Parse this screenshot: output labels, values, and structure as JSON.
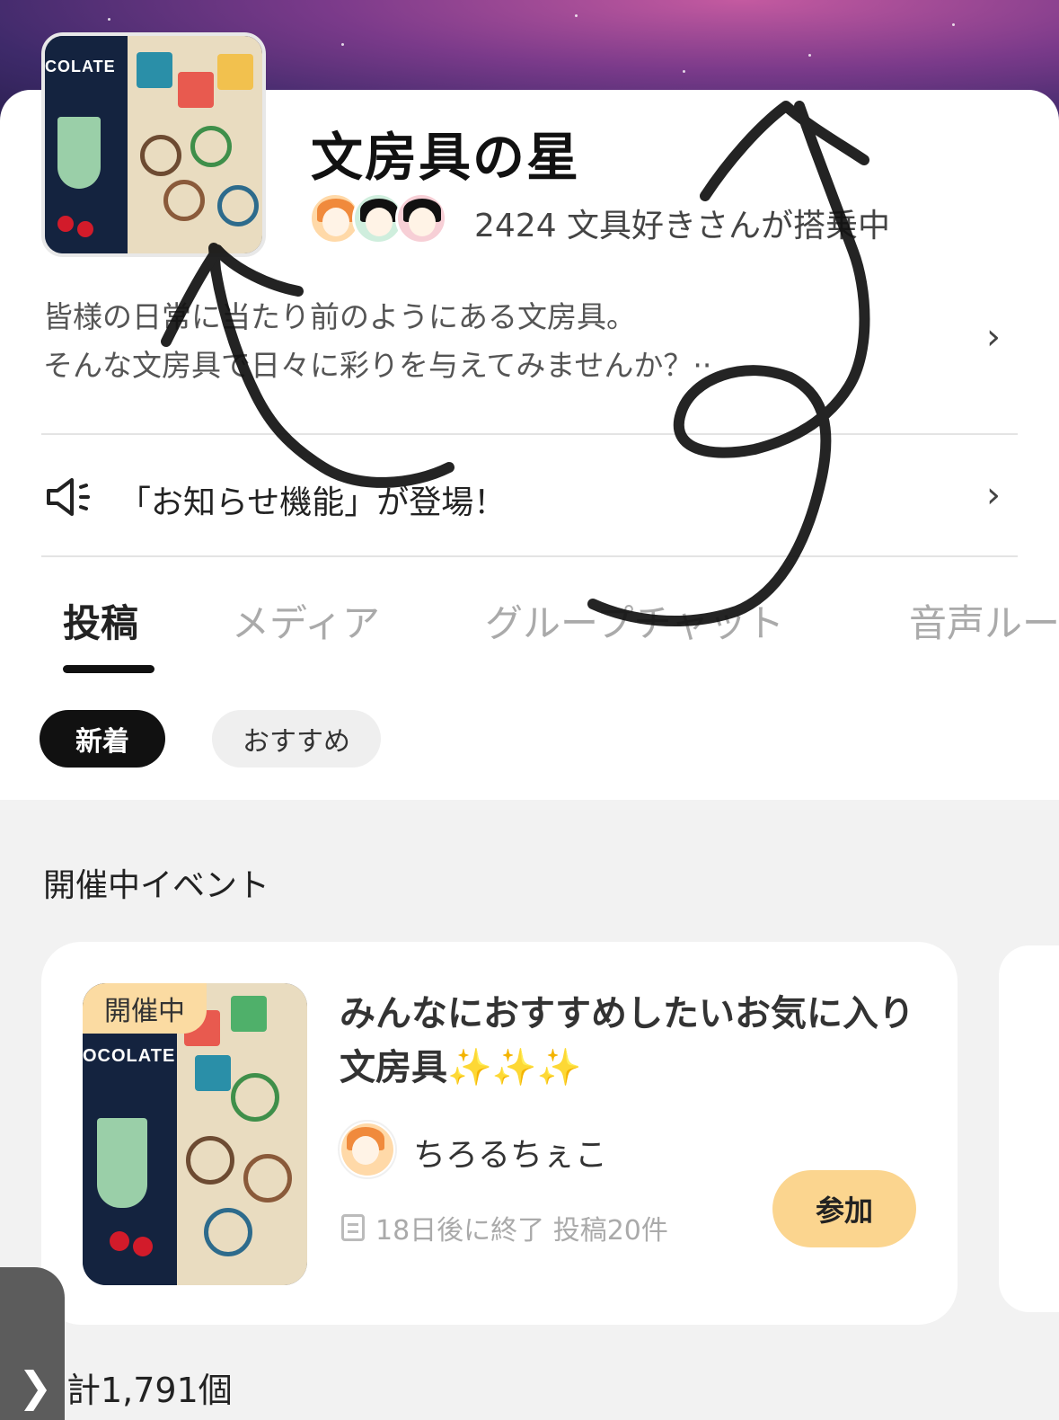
{
  "community": {
    "title": "文房具の星",
    "members_text": "2424 文具好きさんが搭乗中",
    "description_line1": "皆様の日常に当たり前のようにある文房具。",
    "description_line2": "そんな文房具で日々に彩りを与えてみませんか？··"
  },
  "notice": {
    "text": "「お知らせ機能」が登場！"
  },
  "tabs": [
    {
      "label": "投稿",
      "active": true
    },
    {
      "label": "メディア",
      "active": false
    },
    {
      "label": "グループチャット",
      "active": false
    },
    {
      "label": "音声ルー",
      "active": false
    }
  ],
  "filters": {
    "new_label": "新着",
    "recommended_label": "おすすめ"
  },
  "events_section": {
    "title": "開催中イベント",
    "card": {
      "badge": "開催中",
      "title": "みんなにおすすめしたいお気に入り文房具✨✨✨",
      "host": "ちろるちぇこ",
      "meta": "18日後に終了 投稿20件",
      "join_label": "参加",
      "cover_text": "OCOLATE"
    }
  },
  "cover": {
    "text": "COLATE"
  },
  "bottom": {
    "count_text": "計1,791個",
    "handle_glyph": "❯"
  },
  "icons": {
    "chevron": "chevron-right-icon",
    "speaker": "speaker-icon",
    "meta": "document-icon"
  },
  "colors": {
    "accent_chip": "#111111",
    "join_button": "#fbd58f",
    "badge": "#fbdba2",
    "banner": "#7a3a8a"
  }
}
